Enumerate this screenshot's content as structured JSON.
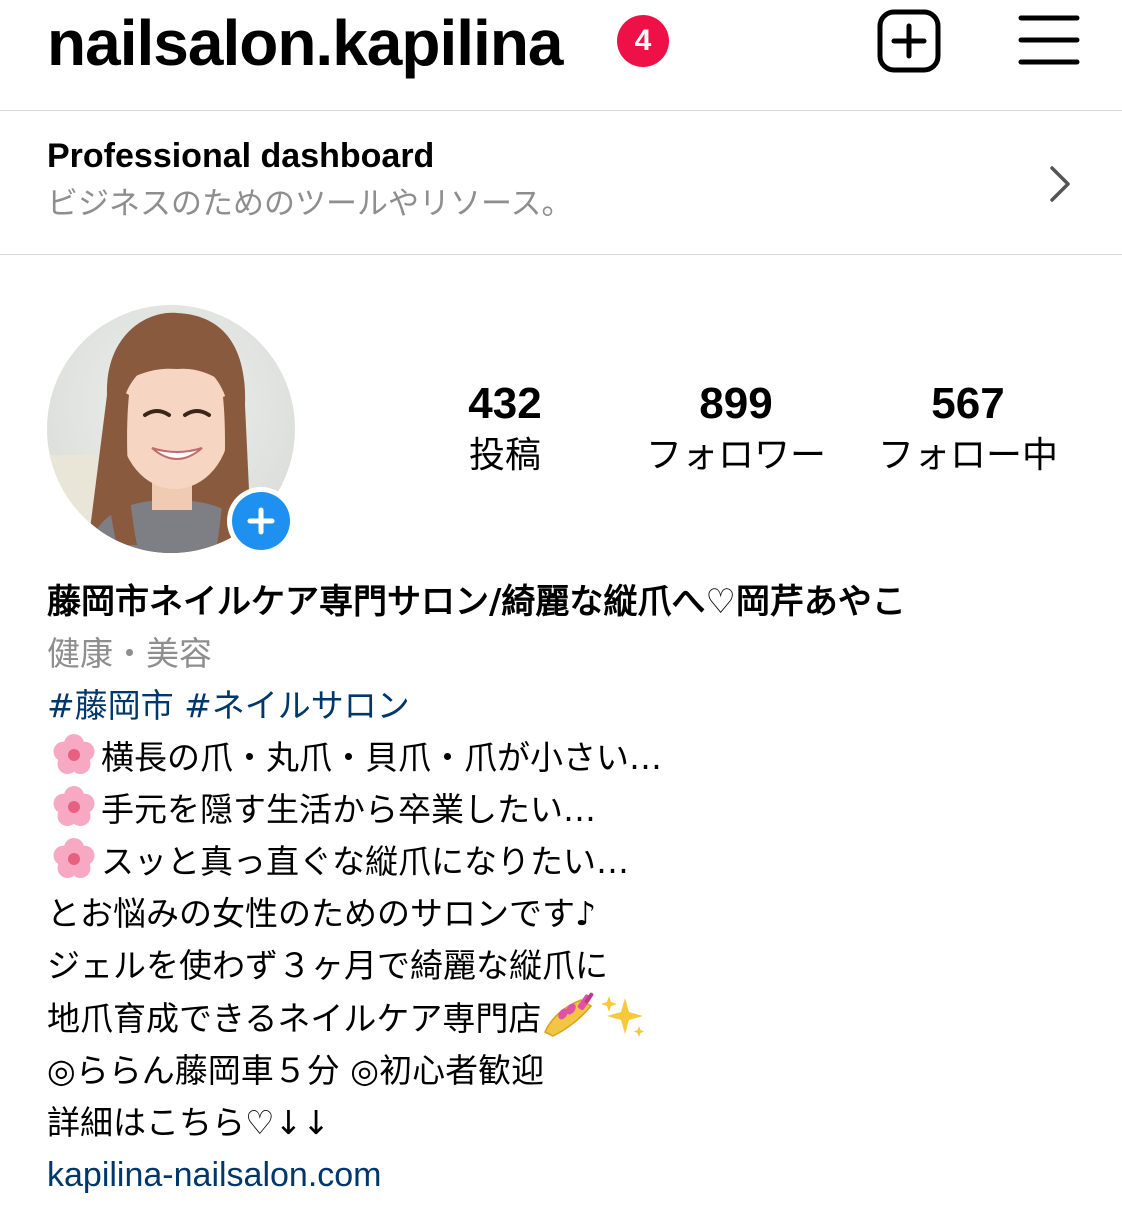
{
  "header": {
    "username": "nailsalon.kapilina",
    "notification_count": "4",
    "add_icon": "plus-square-icon",
    "menu_icon": "hamburger-menu-icon"
  },
  "dashboard": {
    "title": "Professional dashboard",
    "subtitle": "ビジネスのためのツールやリソース。",
    "chevron_icon": "chevron-right-icon"
  },
  "profile": {
    "avatar_icon": "profile-photo",
    "add_story_icon": "plus-icon",
    "stats": [
      {
        "value": "432",
        "label": "投稿"
      },
      {
        "value": "899",
        "label": "フォロワー"
      },
      {
        "value": "567",
        "label": "フォロー中"
      }
    ]
  },
  "bio": {
    "name": "藤岡市ネイルケア専門サロン/綺麗な縦爪へ♡岡芹あやこ",
    "category": "健康・美容",
    "hashtags": [
      "#藤岡市",
      "#ネイルサロン"
    ],
    "lines": [
      "横長の爪・丸爪・貝爪・爪が小さい…",
      "手元を隠す生活から卒業したい…",
      "スッと真っ直ぐな縦爪になりたい…",
      "とお悩みの女性のためのサロンです♪",
      "ジェルを使わず３ヶ月で綺麗な縦爪に",
      "地爪育成できるネイルケア専門店",
      "◎ららん藤岡車５分 ◎初心者歓迎",
      "詳細はこちら♡↓↓"
    ],
    "link": "kapilina-nailsalon.com"
  },
  "colors": {
    "badge": "#ed1148",
    "link": "#00376b",
    "secondary_text": "#8e8e8e",
    "add_button": "#1e90f0"
  }
}
